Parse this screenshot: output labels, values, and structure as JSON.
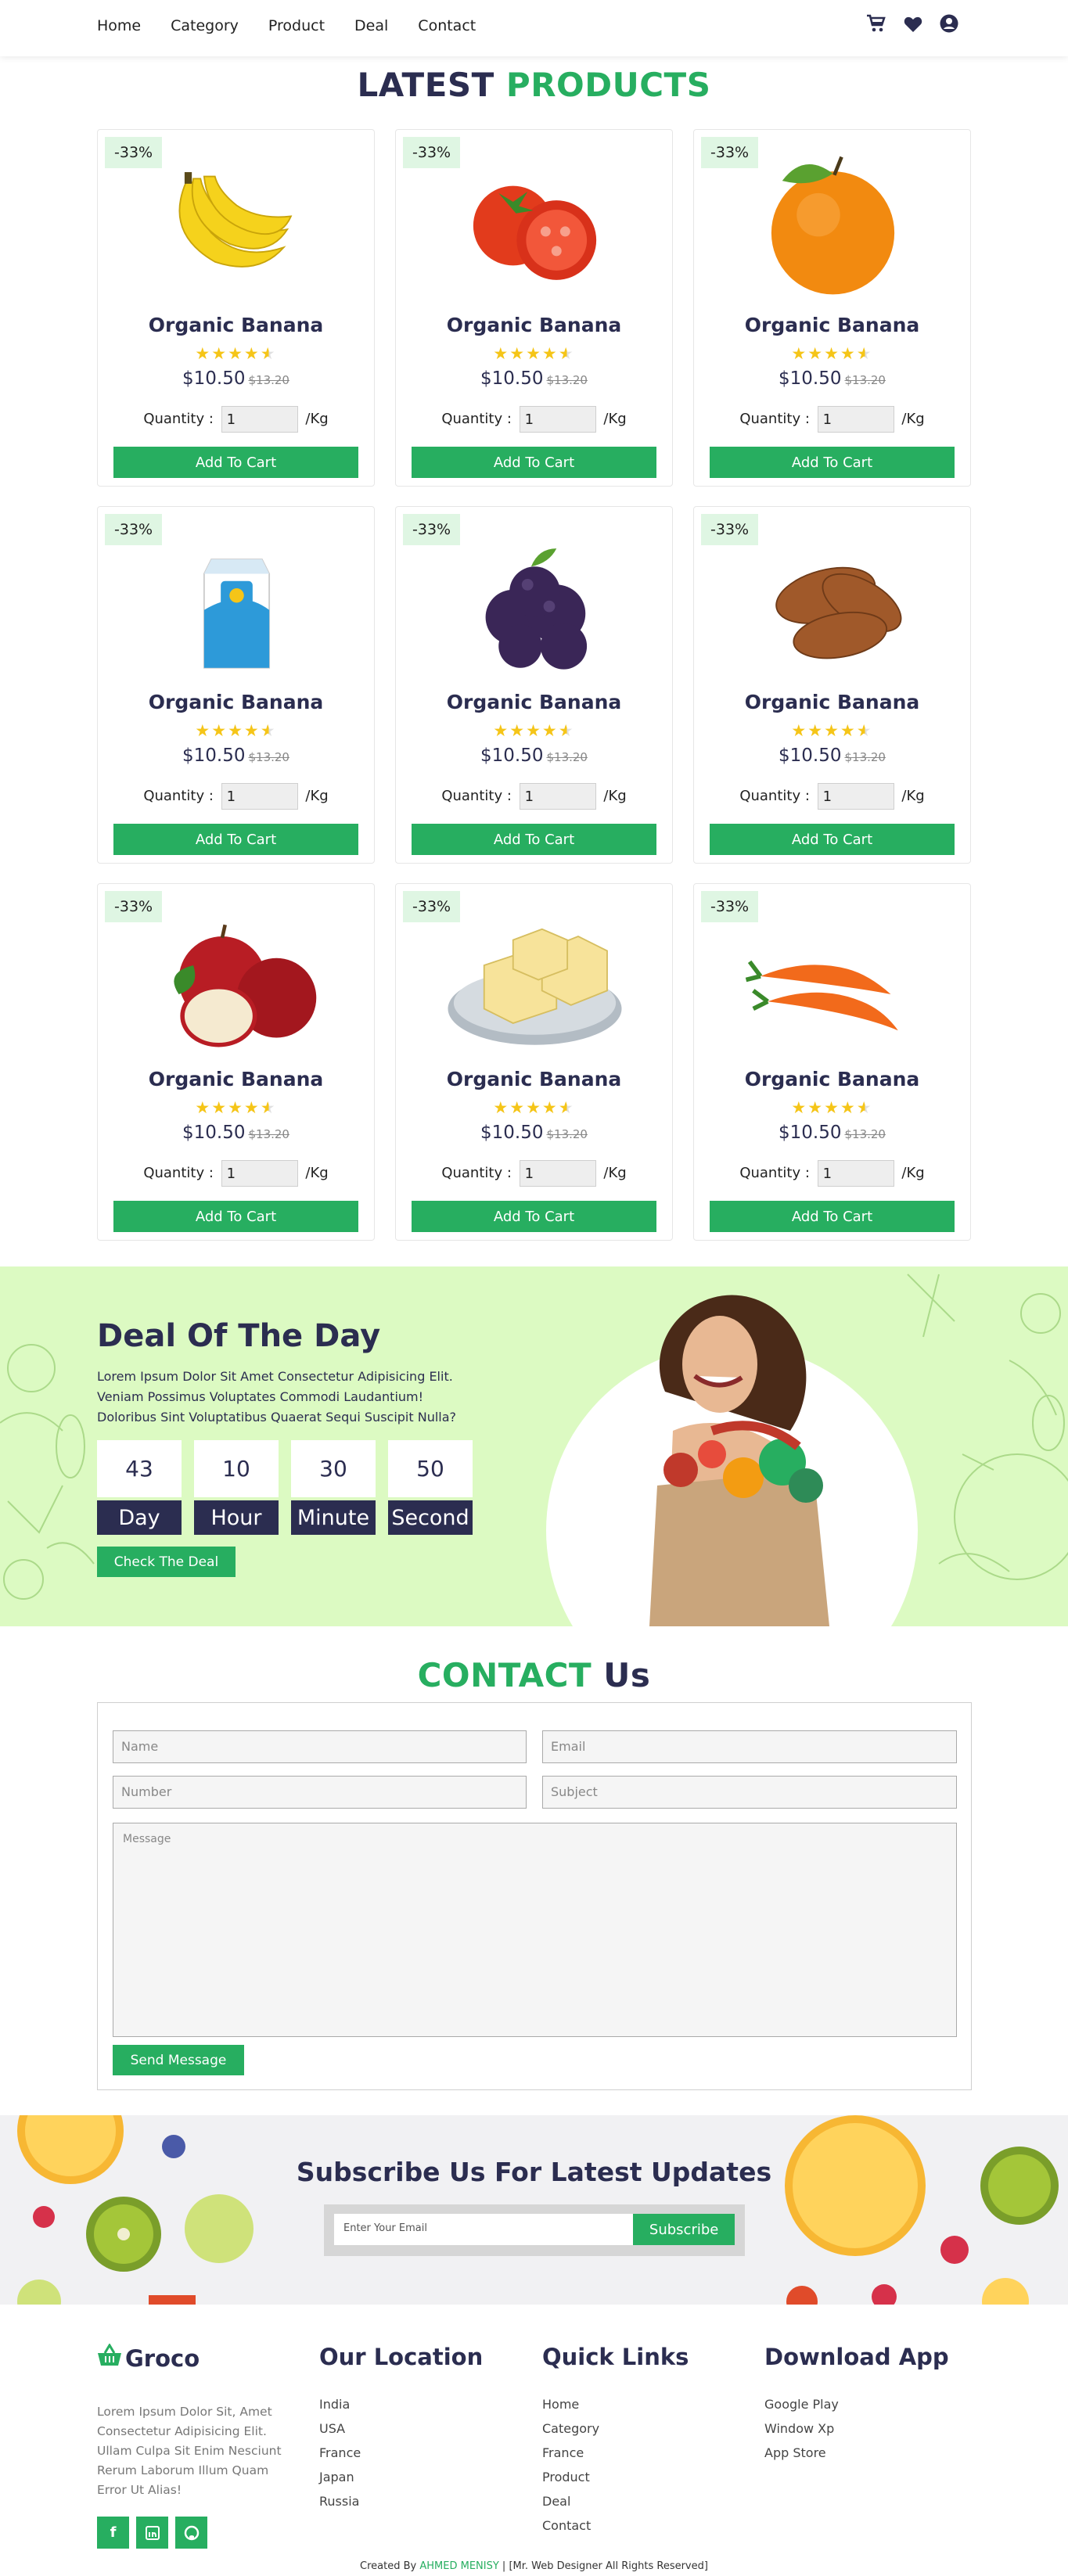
{
  "nav": {
    "links": [
      "Home",
      "Category",
      "Product",
      "Deal",
      "Contact"
    ],
    "icons": [
      "cart-icon",
      "heart-icon",
      "user-icon"
    ]
  },
  "products_section": {
    "title_a": "LATEST",
    "title_b": "PRODUCTS"
  },
  "products": [
    {
      "badge": "-33%",
      "name": "Organic Banana",
      "image": "banana",
      "rating": 4.5,
      "price": "$10.50",
      "old_price": "$13.20",
      "qty_label": "Quantity :",
      "qty_value": "1",
      "unit": "/Kg",
      "button": "Add To Cart"
    },
    {
      "badge": "-33%",
      "name": "Organic Banana",
      "image": "tomato",
      "rating": 4.5,
      "price": "$10.50",
      "old_price": "$13.20",
      "qty_label": "Quantity :",
      "qty_value": "1",
      "unit": "/Kg",
      "button": "Add To Cart"
    },
    {
      "badge": "-33%",
      "name": "Organic Banana",
      "image": "orange",
      "rating": 4.5,
      "price": "$10.50",
      "old_price": "$13.20",
      "qty_label": "Quantity :",
      "qty_value": "1",
      "unit": "/Kg",
      "button": "Add To Cart"
    },
    {
      "badge": "-33%",
      "name": "Organic Banana",
      "image": "milk",
      "rating": 4.5,
      "price": "$10.50",
      "old_price": "$13.20",
      "qty_label": "Quantity :",
      "qty_value": "1",
      "unit": "/Kg",
      "button": "Add To Cart"
    },
    {
      "badge": "-33%",
      "name": "Organic Banana",
      "image": "plum",
      "rating": 4.5,
      "price": "$10.50",
      "old_price": "$13.20",
      "qty_label": "Quantity :",
      "qty_value": "1",
      "unit": "/Kg",
      "button": "Add To Cart"
    },
    {
      "badge": "-33%",
      "name": "Organic Banana",
      "image": "almond",
      "rating": 4.5,
      "price": "$10.50",
      "old_price": "$13.20",
      "qty_label": "Quantity :",
      "qty_value": "1",
      "unit": "/Kg",
      "button": "Add To Cart"
    },
    {
      "badge": "-33%",
      "name": "Organic Banana",
      "image": "apple",
      "rating": 4.5,
      "price": "$10.50",
      "old_price": "$13.20",
      "qty_label": "Quantity :",
      "qty_value": "1",
      "unit": "/Kg",
      "button": "Add To Cart"
    },
    {
      "badge": "-33%",
      "name": "Organic Banana",
      "image": "butter",
      "rating": 4.5,
      "price": "$10.50",
      "old_price": "$13.20",
      "qty_label": "Quantity :",
      "qty_value": "1",
      "unit": "/Kg",
      "button": "Add To Cart"
    },
    {
      "badge": "-33%",
      "name": "Organic Banana",
      "image": "carrot",
      "rating": 4.5,
      "price": "$10.50",
      "old_price": "$13.20",
      "qty_label": "Quantity :",
      "qty_value": "1",
      "unit": "/Kg",
      "button": "Add To Cart"
    }
  ],
  "deal": {
    "title": "Deal Of The Day",
    "text": "Lorem Ipsum Dolor Sit Amet Consectetur Adipisicing Elit. Veniam Possimus Voluptates Commodi Laudantium! Doloribus Sint Voluptatibus Quaerat Sequi Suscipit Nulla?",
    "timer": [
      {
        "value": "43",
        "label": "Day"
      },
      {
        "value": "10",
        "label": "Hour"
      },
      {
        "value": "30",
        "label": "Minute"
      },
      {
        "value": "50",
        "label": "Second"
      }
    ],
    "button": "Check The Deal",
    "background": "#dcfac2"
  },
  "contact": {
    "title_a": "CONTACT",
    "title_b": "Us",
    "name_placeholder": "Name",
    "email_placeholder": "Email",
    "number_placeholder": "Number",
    "subject_placeholder": "Subject",
    "message_placeholder": "Message",
    "button": "Send Message"
  },
  "subscribe": {
    "title": "Subscribe Us For Latest Updates",
    "placeholder": "Enter Your Email",
    "button": "Subscribe"
  },
  "footer": {
    "brand": "Groco",
    "about": "Lorem Ipsum Dolor Sit, Amet Consectetur Adipisicing Elit. Ullam Culpa Sit Enim Nesciunt Rerum Laborum Illum Quam Error Ut Alias!",
    "socials": [
      "facebook-icon",
      "linkedin-icon",
      "github-icon"
    ],
    "location": {
      "title": "Our Location",
      "items": [
        "India",
        "USA",
        "France",
        "Japan",
        "Russia"
      ]
    },
    "links": {
      "title": "Quick Links",
      "items": [
        "Home",
        "Category",
        "France",
        "Product",
        "Deal",
        "Contact"
      ]
    },
    "app": {
      "title": "Download App",
      "items": [
        "Google Play",
        "Window Xp",
        "App Store"
      ]
    },
    "credit_a": "Created By ",
    "credit_name": "AHMED MENISY",
    "credit_b": " | [Mr. Web Designer All Rights Reserved]"
  },
  "colors": {
    "accent": "#27ae60",
    "navy": "#2b2d50",
    "badge": "#dff6e3",
    "star": "#f5c518"
  }
}
